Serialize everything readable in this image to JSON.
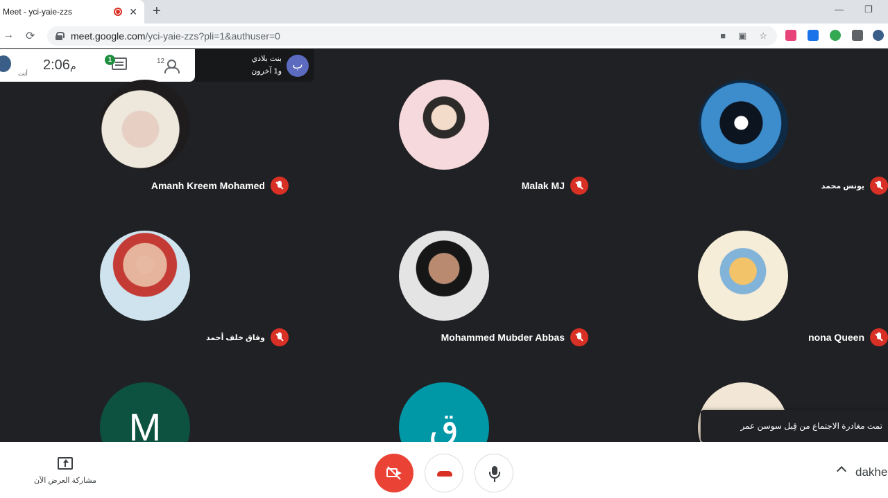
{
  "browser": {
    "tab_title": "Meet - yci-yaie-zzs",
    "url_host": "meet.google.com",
    "url_path": "/yci-yaie-zzs?pli=1&authuser=0"
  },
  "meet_info": {
    "self_label": "أنت",
    "clock_time": "2:06",
    "clock_ampm": "م",
    "chat_unread": "1",
    "people_count": "12"
  },
  "presenter": {
    "initial": "ب",
    "name": "بنت بلادي",
    "others": "و1 آخرون"
  },
  "participants": [
    {
      "name": "Amanh Kreem Mohamed"
    },
    {
      "name": "Malak MJ"
    },
    {
      "name": "يونس محمد"
    },
    {
      "name": "وفاق خلف أحمد"
    },
    {
      "name": "Mohammed Mubder Abbas"
    },
    {
      "name": "nona Queen"
    },
    {
      "initial": "M"
    },
    {
      "initial": "ق"
    }
  ],
  "toast": {
    "message": "تمت مغادرة الاجتماع من قِبل سوسن عمر"
  },
  "controls": {
    "present_label": "مشاركة العرض الآن",
    "meeting_code": "dakhe"
  },
  "colors": {
    "stage_bg": "#202124",
    "mic_off_red": "#d93025",
    "camera_off_red": "#ea4335",
    "chat_badge_green": "#1e8e3e"
  }
}
